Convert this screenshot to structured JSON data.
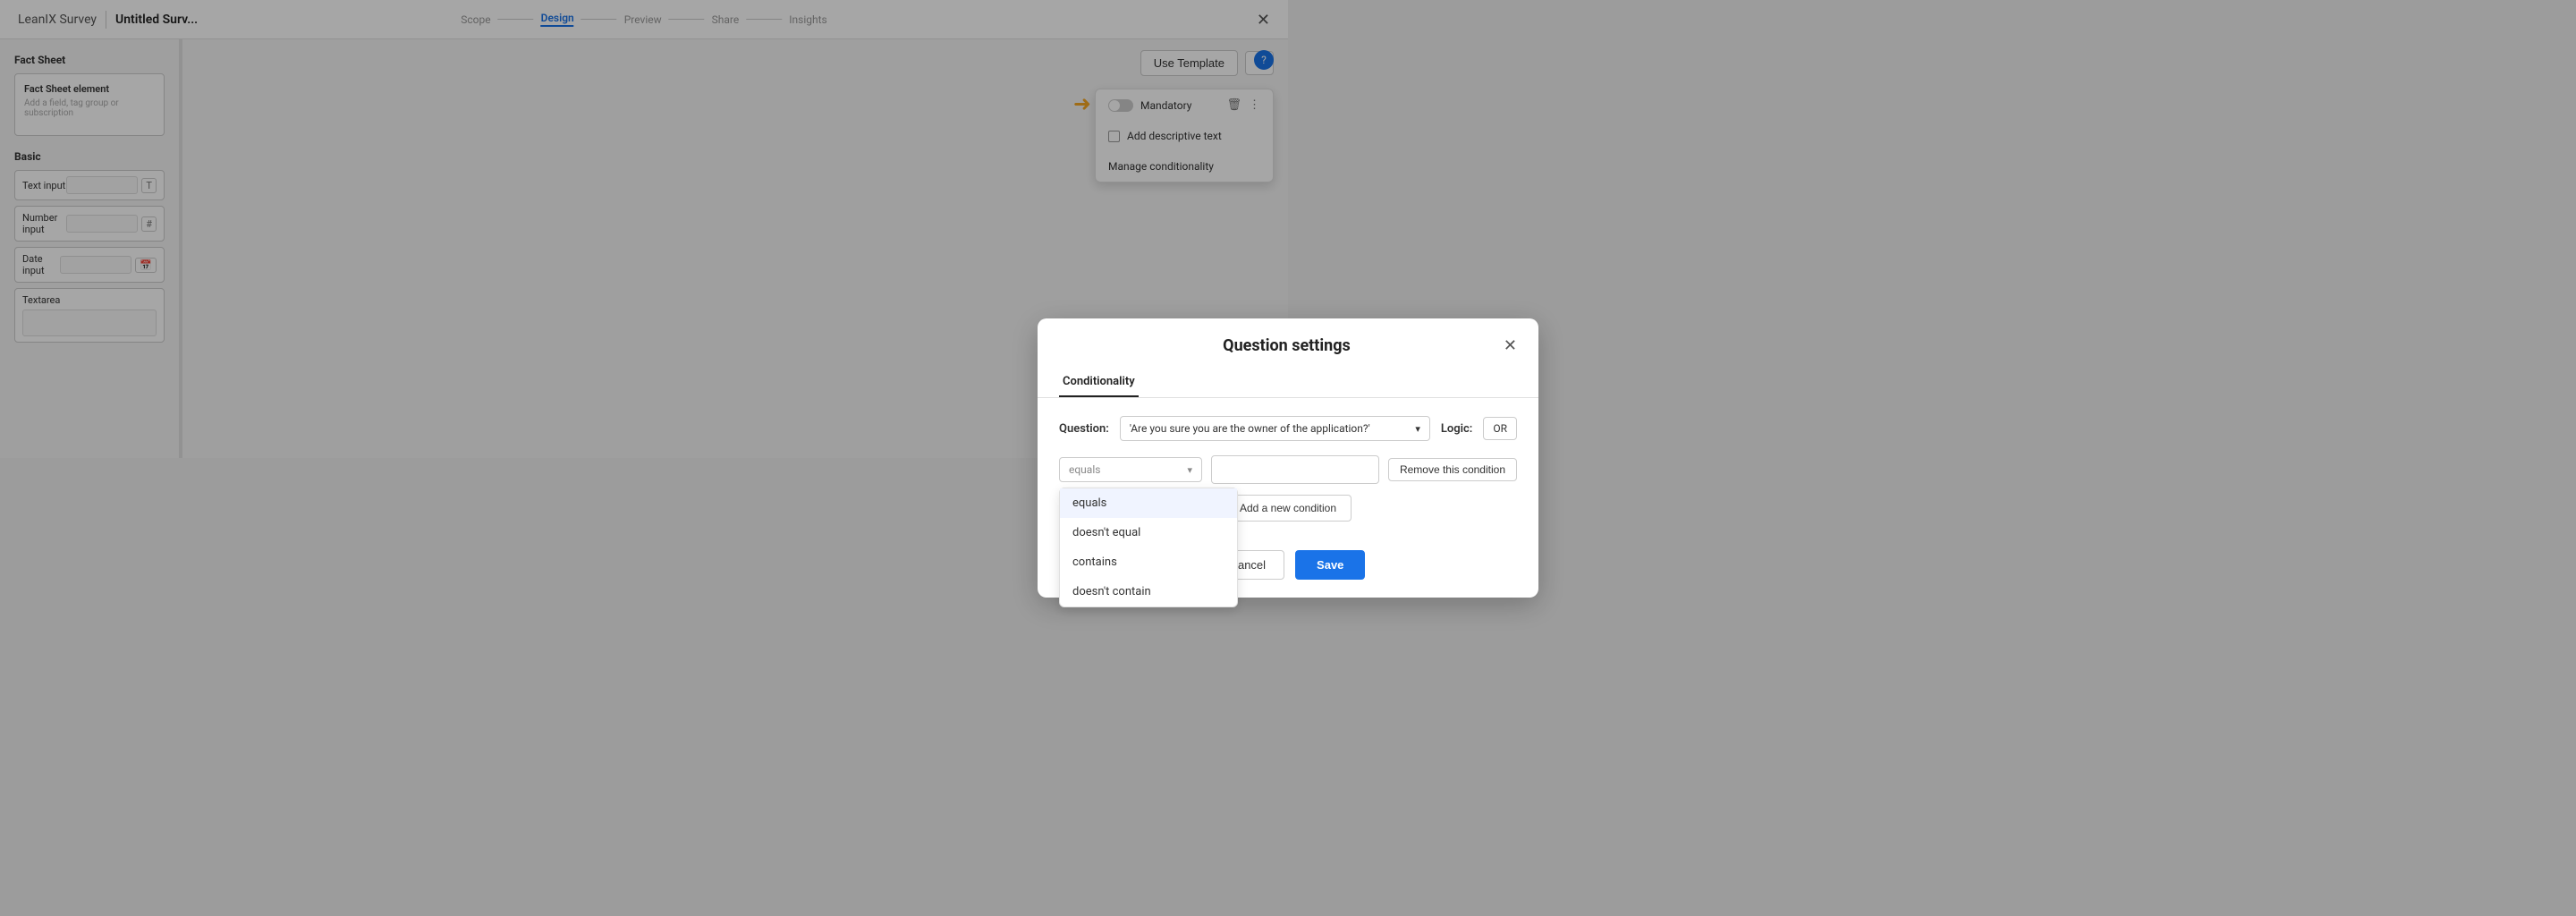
{
  "app": {
    "name": "LeanIX Survey",
    "divider": "|",
    "survey_title": "Untitled Surv...",
    "close_label": "✕"
  },
  "nav": {
    "steps": [
      {
        "label": "Scope",
        "active": false
      },
      {
        "label": "Design",
        "active": true
      },
      {
        "label": "Preview",
        "active": false
      },
      {
        "label": "Share",
        "active": false
      },
      {
        "label": "Insights",
        "active": false
      }
    ]
  },
  "toolbar": {
    "use_template_label": "Use Template",
    "more_label": "⋮"
  },
  "sidebar": {
    "fact_sheet_title": "Fact Sheet",
    "fact_sheet_element": "Fact Sheet element",
    "fact_sheet_sub": "Add a field, tag group or subscription",
    "basic_title": "Basic",
    "basic_items": [
      {
        "label": "Text input",
        "icon": "T"
      },
      {
        "label": "Number input",
        "icon": "#"
      },
      {
        "label": "Date input",
        "icon": "📅"
      }
    ],
    "textarea_label": "Textarea"
  },
  "context_menu": {
    "mandatory_label": "Mandatory",
    "add_descriptive_label": "Add descriptive text",
    "manage_conditionality_label": "Manage conditionality"
  },
  "modal": {
    "title": "Question settings",
    "close_label": "✕",
    "tabs": [
      {
        "label": "Conditionality",
        "active": true
      }
    ],
    "question_label": "Question:",
    "question_value": "'Are you sure you are the owner of the application?'",
    "logic_label": "Logic:",
    "logic_value": "OR",
    "condition": {
      "selected_option": "equals",
      "options": [
        {
          "label": "equals",
          "value": "equals"
        },
        {
          "label": "doesn't equal",
          "value": "doesnt_equal"
        },
        {
          "label": "contains",
          "value": "contains"
        },
        {
          "label": "doesn't contain",
          "value": "doesnt_contain"
        }
      ],
      "value_placeholder": ""
    },
    "remove_condition_label": "Remove this condition",
    "add_condition_label": "Add a new condition",
    "cancel_label": "Cancel",
    "save_label": "Save"
  }
}
